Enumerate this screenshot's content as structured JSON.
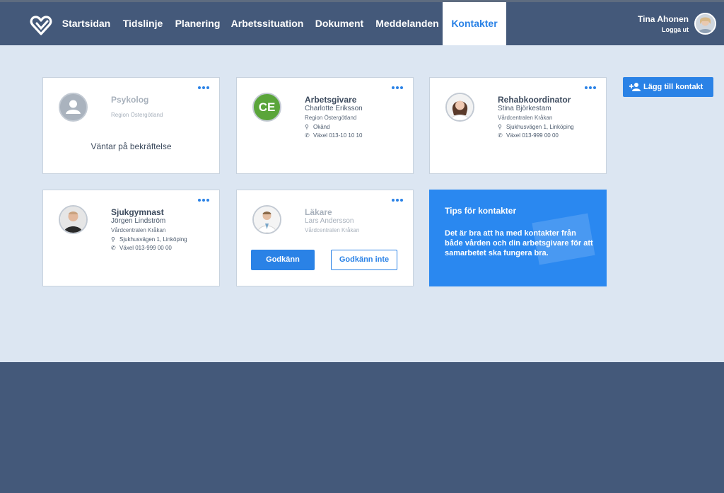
{
  "nav": {
    "items": [
      {
        "label": "Startsidan"
      },
      {
        "label": "Tidslinje"
      },
      {
        "label": "Planering"
      },
      {
        "label": "Arbetssituation"
      },
      {
        "label": "Dokument"
      },
      {
        "label": "Meddelanden"
      },
      {
        "label": "Kontakter",
        "active": true
      }
    ]
  },
  "user": {
    "name": "Tina Ahonen",
    "logout": "Logga ut"
  },
  "add_contact": {
    "label": "Lägg till kontakt"
  },
  "cards": [
    {
      "role": "Psykolog",
      "org": "Region Östergötland",
      "status": "Väntar på bekräftelse"
    },
    {
      "role": "Arbetsgivare",
      "name": "Charlotte Eriksson",
      "org": "Region Östergötland",
      "address": "Okänd",
      "phone": "Växel  013-10 10 10",
      "initials": "CE"
    },
    {
      "role": "Rehabkoordinator",
      "name": "Stina Björkestam",
      "org": "Vårdcentralen Kråkan",
      "address": "Sjukhusvägen 1, Linköping",
      "phone": "Växel  013-999 00 00"
    },
    {
      "role": "Sjukgymnast",
      "name": "Jörgen Lindström",
      "org": "Vårdcentralen Kråkan",
      "address": "Sjukhusvägen 1, Linköping",
      "phone": "Växel  013-999 00 00"
    },
    {
      "role": "Läkare",
      "name": "Lars Andersson",
      "org": "Vårdcentralen Kråkan",
      "approve": "Godkänn",
      "reject": "Godkänn inte"
    }
  ],
  "tips": {
    "title": "Tips för kontakter",
    "text": "Det är bra att ha med kontakter från både vården och din arbetsgivare för att samarbetet ska fungera bra."
  },
  "colors": {
    "header": "#44597a",
    "accent": "#2a82e6",
    "background": "#dce6f2",
    "initials_badge": "#5aa53a"
  }
}
